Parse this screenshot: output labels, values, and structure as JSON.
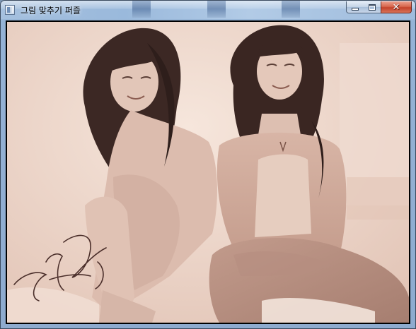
{
  "window": {
    "title": "그림 맞추기 퍼즐",
    "controls": {
      "minimize_glyph": "",
      "maximize_glyph": "",
      "close_glyph": "✕"
    }
  },
  "puzzle_image": {
    "icon": "puzzle-photo",
    "signature_text": "김태희"
  },
  "colors": {
    "sepia_background": "#ead4c8",
    "hair": "#3a2622",
    "skin": "#dcbcae",
    "close_button": "#c3422a",
    "titlebar": "#a5c0de"
  }
}
